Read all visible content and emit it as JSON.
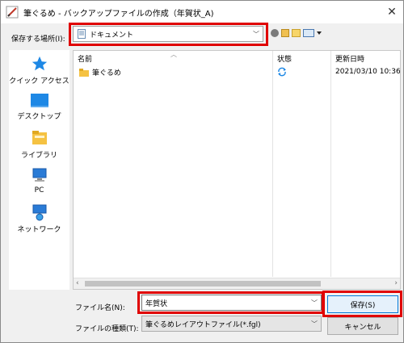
{
  "window": {
    "title": "筆ぐるめ - バックアップファイルの作成（年賀状_A)"
  },
  "location": {
    "label": "保存する場所(I):",
    "value": "ドキュメント"
  },
  "places": [
    {
      "label": "クイック アクセス",
      "icon": "star-icon"
    },
    {
      "label": "デスクトップ",
      "icon": "desktop-icon"
    },
    {
      "label": "ライブラリ",
      "icon": "library-icon"
    },
    {
      "label": "PC",
      "icon": "pc-icon"
    },
    {
      "label": "ネットワーク",
      "icon": "network-icon"
    }
  ],
  "filelist": {
    "columns": {
      "name": "名前",
      "status": "状態",
      "modified": "更新日時"
    },
    "rows": [
      {
        "name": "筆ぐるめ",
        "status_icon": "sync-icon",
        "modified": "2021/03/10 10:36"
      }
    ]
  },
  "form": {
    "filename_label": "ファイル名(N):",
    "filename_value": "年賀状",
    "filetype_label": "ファイルの種類(T):",
    "filetype_value": "筆ぐるめレイアウトファイル(*.fgl)"
  },
  "buttons": {
    "save": "保存(S)",
    "cancel": "キャンセル"
  },
  "colors": {
    "highlight": "#e00000",
    "accent": "#0078d7"
  }
}
